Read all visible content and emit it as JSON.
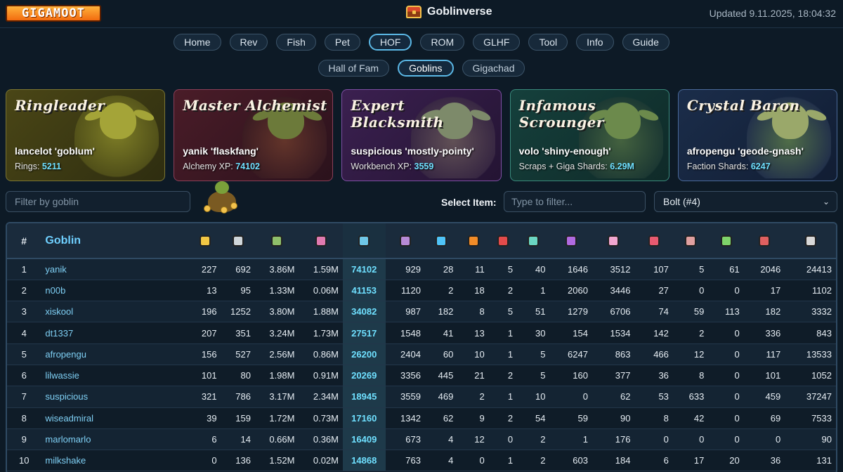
{
  "header": {
    "logo_text": "GIGAMOOT",
    "app_title": "Goblinverse",
    "updated": "Updated 9.11.2025, 18:04:32"
  },
  "nav": {
    "tabs": [
      "Home",
      "Rev",
      "Fish",
      "Pet",
      "HOF",
      "ROM",
      "GLHF",
      "Tool",
      "Info",
      "Guide"
    ],
    "active": "HOF"
  },
  "subnav": {
    "tabs": [
      "Hall of Fam",
      "Goblins",
      "Gigachad"
    ],
    "active": "Goblins"
  },
  "cards": [
    {
      "title": "Ringleader",
      "name": "lancelot 'goblum'",
      "stat_label": "Rings:",
      "stat_value": "5211"
    },
    {
      "title": "Master Alchemist",
      "name": "yanik 'flaskfang'",
      "stat_label": "Alchemy XP:",
      "stat_value": "74102"
    },
    {
      "title": "Expert Blacksmith",
      "name": "suspicious 'mostly-pointy'",
      "stat_label": "Workbench XP:",
      "stat_value": "3559"
    },
    {
      "title": "Infamous Scrounger",
      "name": "volo 'shiny-enough'",
      "stat_label": "Scraps + Giga Shards:",
      "stat_value": "6.29M"
    },
    {
      "title": "Crystal Baron",
      "name": "afropengu 'geode-gnash'",
      "stat_label": "Faction Shards:",
      "stat_value": "6247"
    }
  ],
  "filters": {
    "goblin_placeholder": "Filter by goblin",
    "select_label": "Select Item:",
    "item_placeholder": "Type to filter...",
    "item_selected": "Bolt (#4)"
  },
  "table": {
    "rank_header": "#",
    "name_header": "Goblin",
    "column_icons": [
      {
        "name": "ring-icon",
        "color": "#f2c744"
      },
      {
        "name": "amulet-icon",
        "color": "#cfd6da"
      },
      {
        "name": "cash-icon",
        "color": "#8fbf6a"
      },
      {
        "name": "potion-bag-icon",
        "color": "#e07ab0"
      },
      {
        "name": "alchemy-icon",
        "color": "#6fc6e6"
      },
      {
        "name": "anvil-icon",
        "color": "#b78ad6"
      },
      {
        "name": "flask-icon",
        "color": "#4fc3f7"
      },
      {
        "name": "orange-shard-icon",
        "color": "#f28c28"
      },
      {
        "name": "red-gem-icon",
        "color": "#e34b4b"
      },
      {
        "name": "tv-icon",
        "color": "#6bd6c2"
      },
      {
        "name": "rainbow-crystal-icon",
        "color": "#b06ae0"
      },
      {
        "name": "scroll-icon",
        "color": "#f2a7d0"
      },
      {
        "name": "red-vial-icon",
        "color": "#e85a70"
      },
      {
        "name": "small-vial-icon",
        "color": "#e0a0a0"
      },
      {
        "name": "green-chip-icon",
        "color": "#7ed36a"
      },
      {
        "name": "mushroom-icon",
        "color": "#e06060"
      },
      {
        "name": "bolt-icon",
        "color": "#d8d8d8"
      }
    ],
    "rows": [
      {
        "rank": "1",
        "name": "yanik",
        "values": [
          "227",
          "692",
          "3.86M",
          "1.59M",
          "74102",
          "929",
          "28",
          "11",
          "5",
          "40",
          "1646",
          "3512",
          "107",
          "5",
          "61",
          "2046",
          "24413"
        ]
      },
      {
        "rank": "2",
        "name": "n00b",
        "values": [
          "13",
          "95",
          "1.33M",
          "0.06M",
          "41153",
          "1120",
          "2",
          "18",
          "2",
          "1",
          "2060",
          "3446",
          "27",
          "0",
          "0",
          "17",
          "1102"
        ]
      },
      {
        "rank": "3",
        "name": "xiskool",
        "values": [
          "196",
          "1252",
          "3.80M",
          "1.88M",
          "34082",
          "987",
          "182",
          "8",
          "5",
          "51",
          "1279",
          "6706",
          "74",
          "59",
          "113",
          "182",
          "3332"
        ]
      },
      {
        "rank": "4",
        "name": "dt1337",
        "values": [
          "207",
          "351",
          "3.24M",
          "1.73M",
          "27517",
          "1548",
          "41",
          "13",
          "1",
          "30",
          "154",
          "1534",
          "142",
          "2",
          "0",
          "336",
          "843"
        ]
      },
      {
        "rank": "5",
        "name": "afropengu",
        "values": [
          "156",
          "527",
          "2.56M",
          "0.86M",
          "26200",
          "2404",
          "60",
          "10",
          "1",
          "5",
          "6247",
          "863",
          "466",
          "12",
          "0",
          "117",
          "13533"
        ]
      },
      {
        "rank": "6",
        "name": "lilwassie",
        "values": [
          "101",
          "80",
          "1.98M",
          "0.91M",
          "20269",
          "3356",
          "445",
          "21",
          "2",
          "5",
          "160",
          "377",
          "36",
          "8",
          "0",
          "101",
          "1052"
        ]
      },
      {
        "rank": "7",
        "name": "suspicious",
        "values": [
          "321",
          "786",
          "3.17M",
          "2.34M",
          "18945",
          "3559",
          "469",
          "2",
          "1",
          "10",
          "0",
          "62",
          "53",
          "633",
          "0",
          "459",
          "37247"
        ]
      },
      {
        "rank": "8",
        "name": "wiseadmiral",
        "values": [
          "39",
          "159",
          "1.72M",
          "0.73M",
          "17160",
          "1342",
          "62",
          "9",
          "2",
          "54",
          "59",
          "90",
          "8",
          "42",
          "0",
          "69",
          "7533"
        ]
      },
      {
        "rank": "9",
        "name": "marlomarlo",
        "values": [
          "6",
          "14",
          "0.66M",
          "0.36M",
          "16409",
          "673",
          "4",
          "12",
          "0",
          "2",
          "1",
          "176",
          "0",
          "0",
          "0",
          "0",
          "90"
        ]
      },
      {
        "rank": "10",
        "name": "milkshake",
        "values": [
          "0",
          "136",
          "1.52M",
          "0.02M",
          "14868",
          "763",
          "4",
          "0",
          "1",
          "2",
          "603",
          "184",
          "6",
          "17",
          "20",
          "36",
          "131"
        ]
      }
    ]
  }
}
